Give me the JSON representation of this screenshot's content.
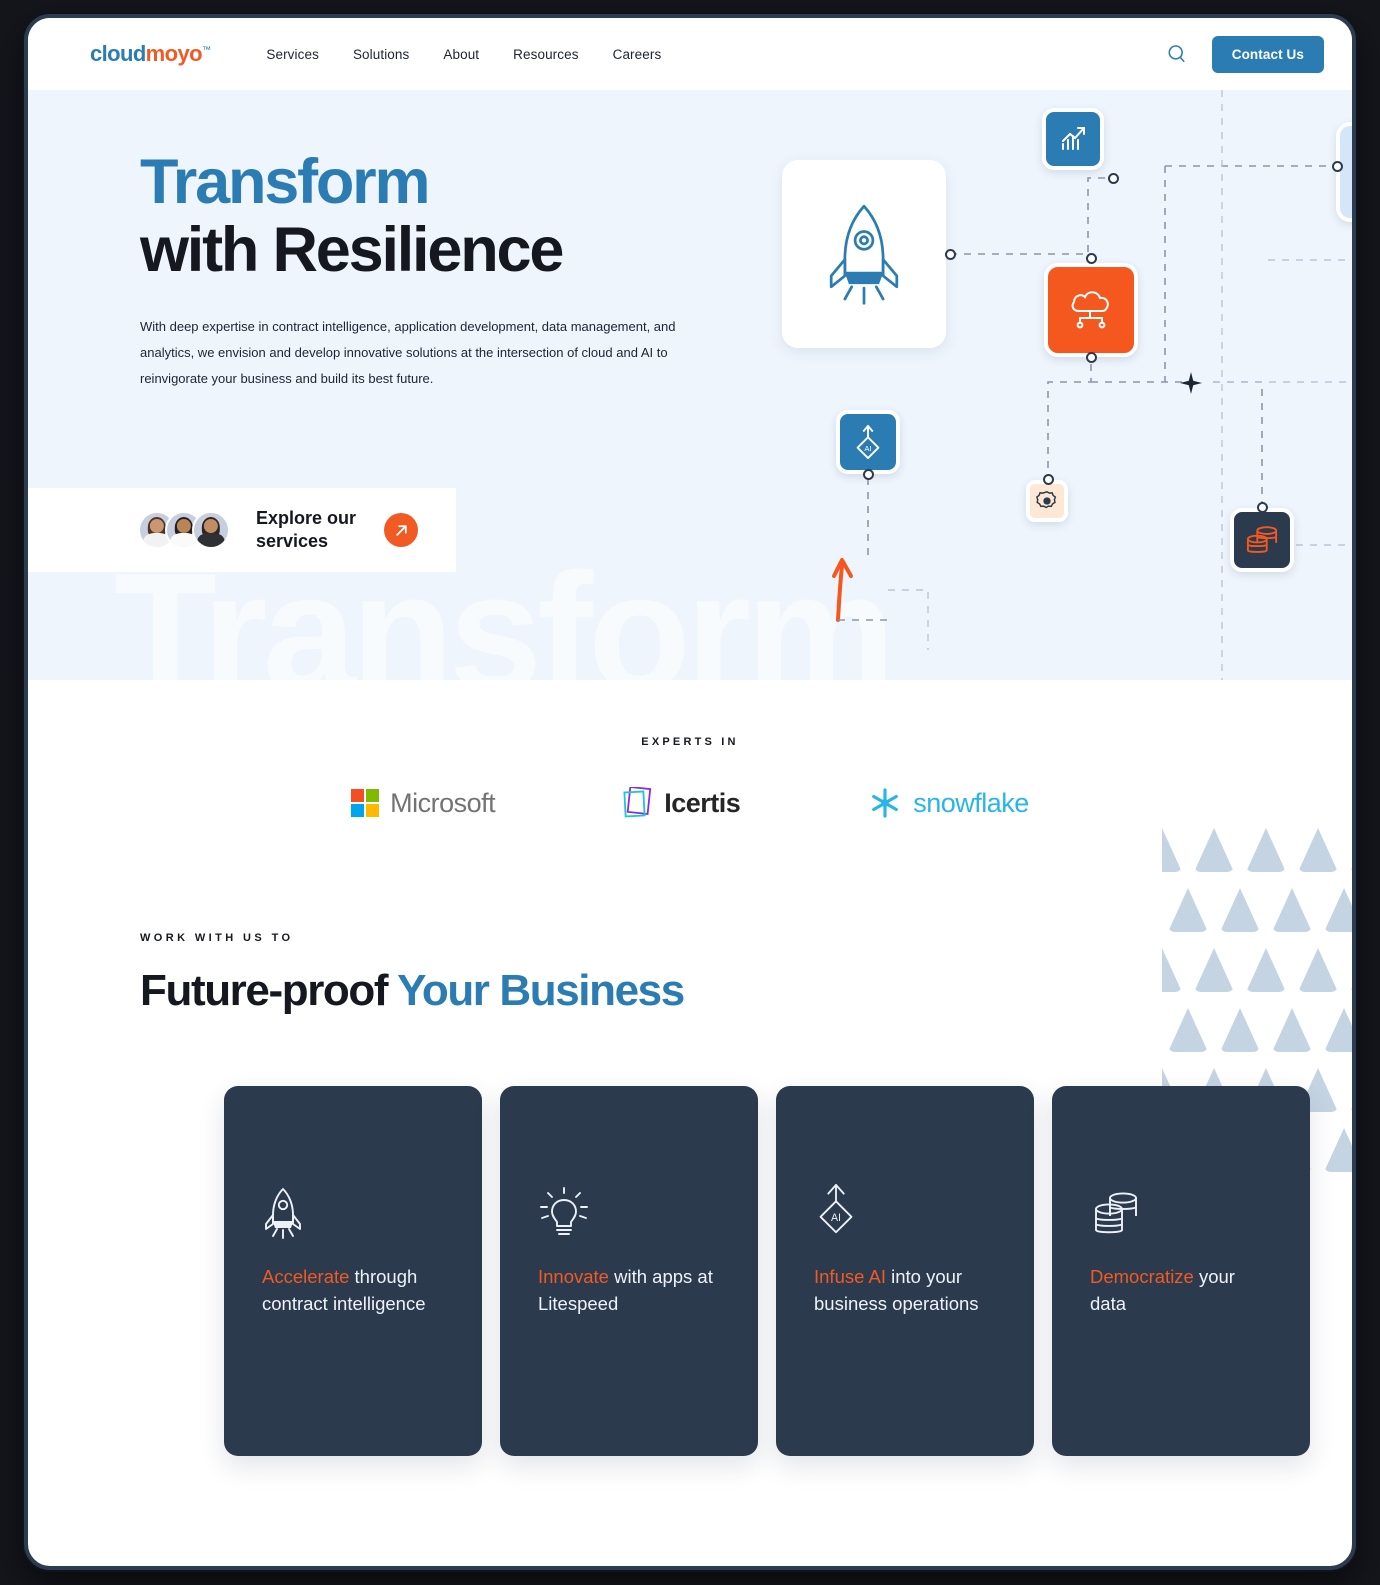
{
  "header": {
    "logo": {
      "part1": "cloud",
      "part2": "moyo",
      "tm": "™"
    },
    "nav": [
      {
        "label": "Services"
      },
      {
        "label": "Solutions"
      },
      {
        "label": "About"
      },
      {
        "label": "Resources"
      },
      {
        "label": "Careers"
      }
    ],
    "search_icon": "search-icon",
    "contact_button": "Contact Us"
  },
  "hero": {
    "watermark": "Transform",
    "title_line1": "Transform",
    "title_line2": "with Resilience",
    "subtitle": "With deep expertise in contract intelligence, application development, data management, and analytics, we envision and develop innovative solutions at the intersection of cloud and AI to reinvigorate your business and build its best future.",
    "cta_text_line1": "Explore our",
    "cta_text_line2": "services",
    "cta_arrow_icon": "arrow-up-right-icon",
    "nodes": [
      {
        "name": "rocket-node",
        "icon": "rocket-icon",
        "color": "#ffffff"
      },
      {
        "name": "growth-chart-node",
        "icon": "chart-growth-icon",
        "color": "#2b7cb3"
      },
      {
        "name": "cloud-node",
        "icon": "cloud-network-icon",
        "color": "#f4581f"
      },
      {
        "name": "ai-node",
        "icon": "ai-diamond-icon",
        "color": "#2b7cb3"
      },
      {
        "name": "security-badge-node",
        "icon": "security-badge-icon",
        "color": "#fce8d4"
      },
      {
        "name": "database-node",
        "icon": "database-icon",
        "color": "#2b3a4d"
      },
      {
        "name": "side-card-node",
        "icon": "side-card-icon",
        "color": "#d6e6fa"
      }
    ]
  },
  "experts": {
    "label": "EXPERTS IN",
    "brands": [
      {
        "name": "Microsoft",
        "icon": "microsoft-logo",
        "color": "#737373"
      },
      {
        "name": "Icertis",
        "icon": "icertis-logo",
        "color": "#262626"
      },
      {
        "name": "snowflake",
        "icon": "snowflake-logo",
        "color": "#29b5e8"
      }
    ]
  },
  "future_proof": {
    "kicker": "WORK WITH US TO",
    "title_dark": "Future-proof ",
    "title_accent": "Your Business"
  },
  "cards": [
    {
      "icon": "rocket-icon",
      "emphasis": "Accelerate",
      "rest": " through contract intelligence"
    },
    {
      "icon": "lightbulb-icon",
      "emphasis": "Innovate",
      "rest": " with apps at Litespeed"
    },
    {
      "icon": "ai-diamond-icon",
      "emphasis": "Infuse AI",
      "rest": " into your business operations"
    },
    {
      "icon": "database-icon",
      "emphasis": "Democratize",
      "rest": " your data"
    }
  ],
  "colors": {
    "brand_blue": "#2b7cb3",
    "brand_orange": "#f15a22",
    "card_navy": "#2b3a4d",
    "hero_bg": "#eef5fd"
  }
}
